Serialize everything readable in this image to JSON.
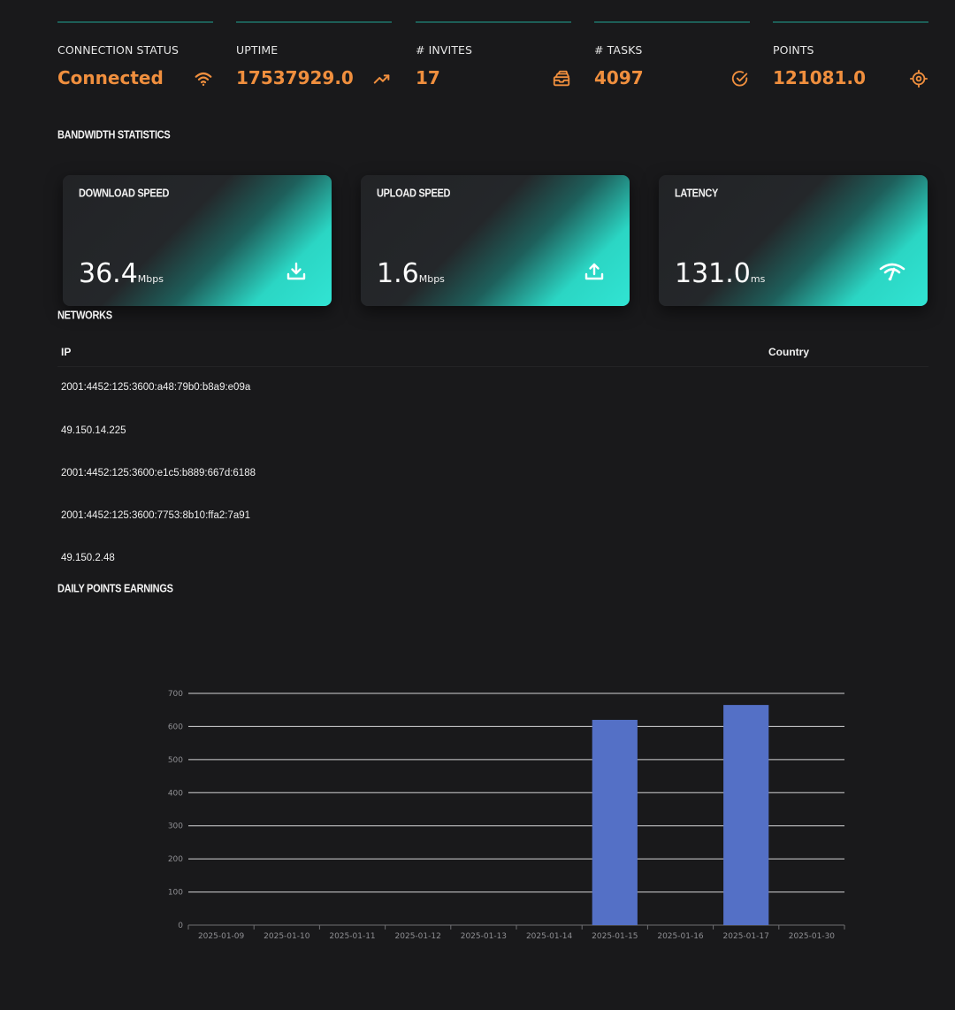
{
  "stats": [
    {
      "label": "CONNECTION STATUS",
      "value": "Connected",
      "icon": "wifi-icon"
    },
    {
      "label": "UPTIME",
      "value": "17537929.0",
      "icon": "trending-up-icon"
    },
    {
      "label": "# INVITES",
      "value": "17",
      "icon": "layers-icon"
    },
    {
      "label": "# TASKS",
      "value": "4097",
      "icon": "check-circle-icon"
    },
    {
      "label": "POINTS",
      "value": "121081.0",
      "icon": "target-icon"
    }
  ],
  "bandwidth": {
    "title": "BANDWIDTH STATISTICS",
    "cards": [
      {
        "title": "DOWNLOAD SPEED",
        "value": "36.4",
        "unit": "Mbps",
        "icon": "download-icon"
      },
      {
        "title": "UPLOAD SPEED",
        "value": "1.6",
        "unit": "Mbps",
        "icon": "upload-icon"
      },
      {
        "title": "LATENCY",
        "value": "131.0",
        "unit": "ms",
        "icon": "signal-icon"
      }
    ]
  },
  "networks": {
    "title": "NETWORKS",
    "columns": [
      "IP",
      "Country"
    ],
    "rows": [
      {
        "ip": "2001:4452:125:3600:a48:79b0:b8a9:e09a",
        "country": ""
      },
      {
        "ip": "49.150.14.225",
        "country": ""
      },
      {
        "ip": "2001:4452:125:3600:e1c5:b889:667d:6188",
        "country": ""
      },
      {
        "ip": "2001:4452:125:3600:7753:8b10:ffa2:7a91",
        "country": ""
      },
      {
        "ip": "49.150.2.48",
        "country": ""
      }
    ]
  },
  "daily_points": {
    "title": "DAILY POINTS EARNINGS"
  },
  "colors": {
    "accent": "#f08f3e",
    "bar": "#5470c6",
    "teal": "#2bd6c4"
  },
  "chart_data": {
    "type": "bar",
    "title": "",
    "xlabel": "",
    "ylabel": "",
    "categories": [
      "2025-01-09",
      "2025-01-10",
      "2025-01-11",
      "2025-01-12",
      "2025-01-13",
      "2025-01-14",
      "2025-01-15",
      "2025-01-16",
      "2025-01-17",
      "2025-01-30"
    ],
    "values": [
      0,
      0,
      0,
      0,
      0,
      0,
      620,
      0,
      665,
      0
    ],
    "ylim": [
      0,
      700
    ],
    "yticks": [
      0,
      100,
      200,
      300,
      400,
      500,
      600,
      700
    ],
    "grid": true
  }
}
